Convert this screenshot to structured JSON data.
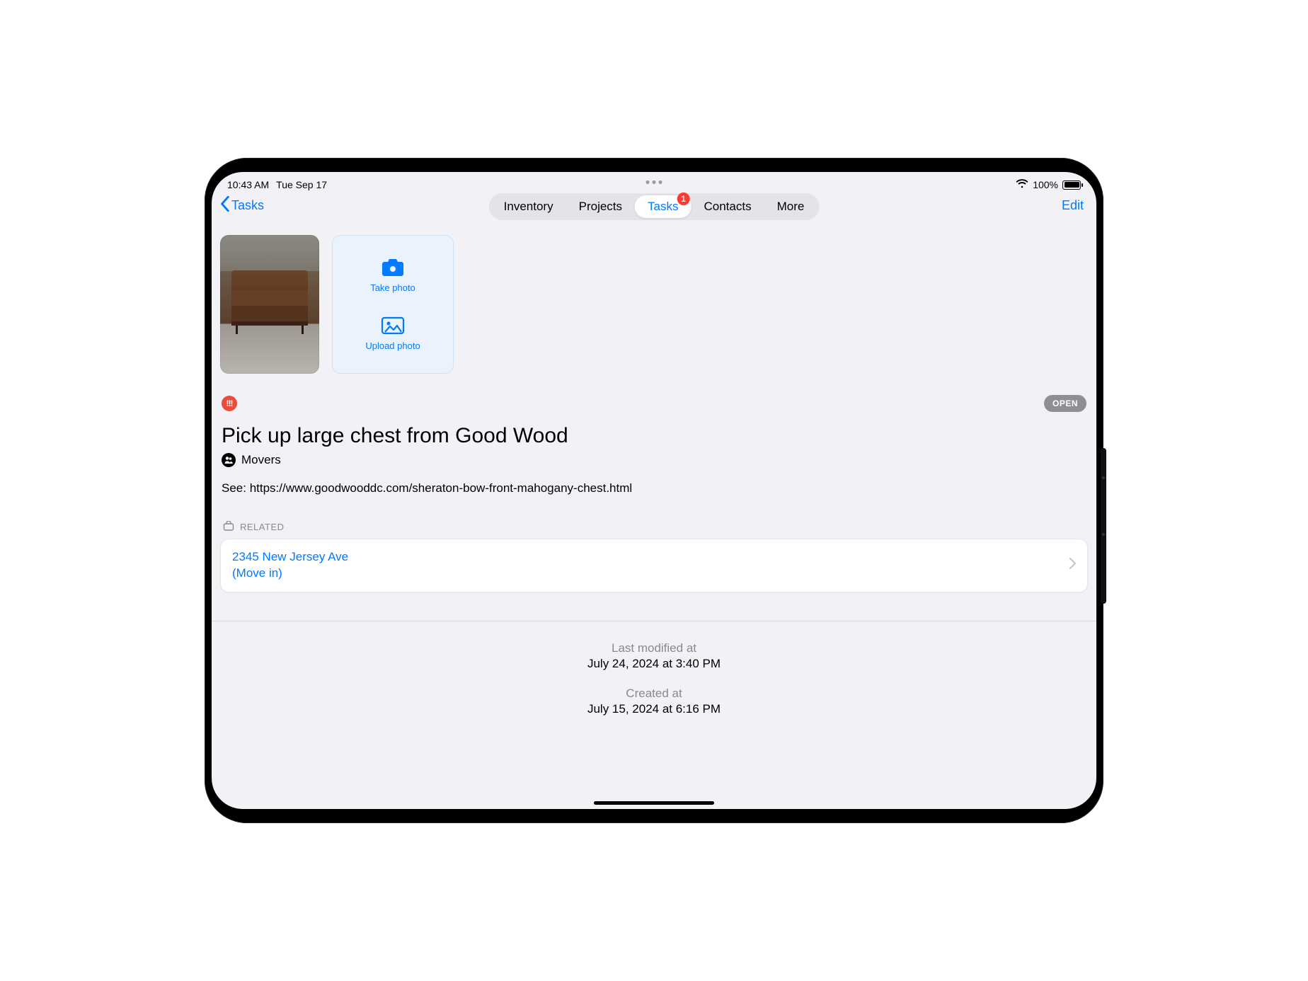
{
  "status_bar": {
    "time": "10:43 AM",
    "date": "Tue Sep 17",
    "battery_percent": "100%"
  },
  "nav": {
    "back_label": "Tasks",
    "edit_label": "Edit",
    "tabs": [
      {
        "label": "Inventory"
      },
      {
        "label": "Projects"
      },
      {
        "label": "Tasks",
        "selected": true,
        "badge": "1"
      },
      {
        "label": "Contacts"
      },
      {
        "label": "More"
      }
    ]
  },
  "photo_actions": {
    "take_photo": "Take photo",
    "upload_photo": "Upload photo"
  },
  "task": {
    "priority_glyph": "!!!",
    "status_label": "OPEN",
    "title": "Pick up large chest from Good Wood",
    "assignee": "Movers",
    "description": "See: https://www.goodwooddc.com/sheraton-bow-front-mahogany-chest.html"
  },
  "related": {
    "header": "RELATED",
    "item_line1": "2345 New Jersey Ave",
    "item_line2": "(Move in)"
  },
  "meta": {
    "last_modified_label": "Last modified at",
    "last_modified_value": "July 24, 2024 at 3:40 PM",
    "created_label": "Created at",
    "created_value": "July 15, 2024 at 6:16 PM"
  }
}
